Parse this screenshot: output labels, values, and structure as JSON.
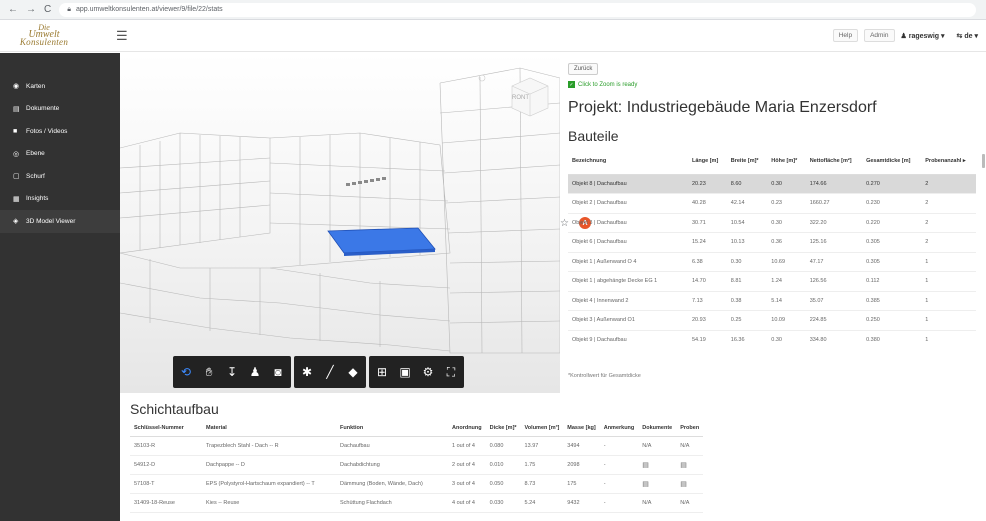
{
  "browser": {
    "back": "←",
    "forward": "→",
    "reload": "C",
    "url": "app.umweltkonsulenten.at/viewer/9/file/22/stats",
    "profile_initial": "A"
  },
  "header": {
    "logo_line1": "Die",
    "logo_line2": "Umwelt",
    "logo_line3": "Konsulenten",
    "help_label": "Help",
    "admin_label": "Admin",
    "user_label": "rageswig ▾",
    "lang_label": "de ▾"
  },
  "sidebar": {
    "items": [
      {
        "icon": "location-icon",
        "glyph": "◉",
        "label": "Karten"
      },
      {
        "icon": "document-icon",
        "glyph": "▤",
        "label": "Dokumente"
      },
      {
        "icon": "video-icon",
        "glyph": "■",
        "label": "Fotos / Videos"
      },
      {
        "icon": "layers-icon",
        "glyph": "◎",
        "label": "Ebene"
      },
      {
        "icon": "grid-icon",
        "glyph": "▢",
        "label": "Schurf"
      },
      {
        "icon": "chart-icon",
        "glyph": "▦",
        "label": "Insights"
      },
      {
        "icon": "cube-icon",
        "glyph": "◈",
        "label": "3D Model Viewer"
      }
    ]
  },
  "viewer": {
    "viewcube_label": "RONT"
  },
  "panel": {
    "back_label": "Zurück",
    "zoom_note": "Click to Zoom is ready",
    "project_title": "Projekt: Industriegebäude Maria Enzersdorf",
    "section_title": "Bauteile",
    "columns": [
      "Bezeichnung",
      "Länge [m]",
      "Breite [m]*",
      "Höhe [m]*",
      "Nettofläche [m²]",
      "Gesamtdicke [m]",
      "Probenanzahl ▸"
    ],
    "rows": [
      [
        "Objekt 8 | Dachaufbau",
        "20.23",
        "8.60",
        "0.30",
        "174.66",
        "0.270",
        "2"
      ],
      [
        "Objekt 2 | Dachaufbau",
        "40.28",
        "42.14",
        "0.23",
        "1660.27",
        "0.230",
        "2"
      ],
      [
        "Objekt 3 | Dachaufbau",
        "30.71",
        "10.54",
        "0.30",
        "322.20",
        "0.220",
        "2"
      ],
      [
        "Objekt 6 | Dachaufbau",
        "15.24",
        "10.13",
        "0.36",
        "125.16",
        "0.305",
        "2"
      ],
      [
        "Objekt 1 | Außenwand O 4",
        "6.38",
        "0.30",
        "10.69",
        "47.17",
        "0.305",
        "1"
      ],
      [
        "Objekt 1 | abgehängte Decke EG 1",
        "14.70",
        "8.81",
        "1.24",
        "126.56",
        "0.112",
        "1"
      ],
      [
        "Objekt 4 | Innenwand 2",
        "7.13",
        "0.38",
        "5.14",
        "35.07",
        "0.385",
        "1"
      ],
      [
        "Objekt 3 | Außenwand O1",
        "20.93",
        "0.25",
        "10.09",
        "224.85",
        "0.250",
        "1"
      ],
      [
        "Objekt 9 | Dachaufbau",
        "54.19",
        "16.36",
        "0.30",
        "334.80",
        "0.380",
        "1"
      ]
    ],
    "footnote": "*Kontrollwert für Gesamtdicke"
  },
  "schicht": {
    "title": "Schichtaufbau",
    "columns": [
      "Schlüssel-Nummer",
      "Material",
      "Funktion",
      "Anordnung",
      "Dicke [m]*",
      "Volumen [m³]",
      "Masse [kg]",
      "Anmerkung",
      "Dokumente",
      "Proben"
    ],
    "rows": [
      [
        "35103-R",
        "Trapezblech Stahl - Dach -- R",
        "Dachaufbau",
        "1 out of 4",
        "0.080",
        "13.97",
        "3494",
        "-",
        "N/A",
        "N/A"
      ],
      [
        "54912-D",
        "Dachpappe -- D",
        "Dachabdichtung",
        "2 out of 4",
        "0.010",
        "1.75",
        "2098",
        "-",
        "▤",
        "▤"
      ],
      [
        "57108-T",
        "EPS (Polystyrol-Hartschaum expandiert) -- T",
        "Dämmung (Boden, Wände, Dach)",
        "3 out of 4",
        "0.050",
        "8.73",
        "175",
        "-",
        "▤",
        "▤"
      ],
      [
        "31409-18-Reuse",
        "Kies -- Reuse",
        "Schüttung Flachdach",
        "4 out of 4",
        "0.030",
        "5.24",
        "9432",
        "-",
        "N/A",
        "N/A"
      ]
    ]
  }
}
